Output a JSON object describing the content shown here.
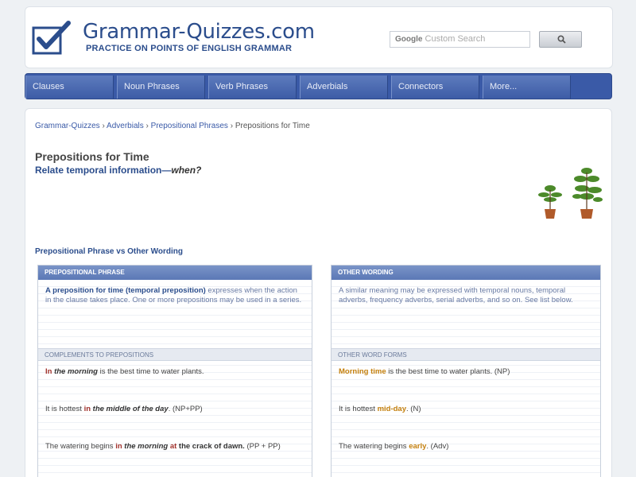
{
  "header": {
    "site_title": "Grammar-Quizzes.com",
    "tagline": "PRACTICE ON POINTS OF ENGLISH GRAMMAR",
    "search_placeholder": "Custom Search",
    "search_brand": "Google"
  },
  "nav": {
    "items": [
      "Clauses",
      "Noun Phrases",
      "Verb Phrases",
      "Adverbials",
      "Connectors",
      "More..."
    ]
  },
  "breadcrumb": {
    "items": [
      "Grammar-Quizzes",
      "Adverbials",
      "Prepositional Phrases"
    ],
    "separator": "›",
    "current": "Prepositions for Time"
  },
  "page": {
    "title": "Prepositions for Time",
    "subtitle_main": "Relate temporal information—",
    "subtitle_em": "when?",
    "section_heading": "Prepositional Phrase vs Other Wording"
  },
  "left_panel": {
    "header": "PREPOSITIONAL PHRASE",
    "body_bold": "A preposition for time (temporal preposition)",
    "body_rest": " expresses when the action in the clause takes place. One or more prepositions may be used in a series.",
    "subheader": "COMPLEMENTS TO PREPOSITIONS",
    "ex1": {
      "hl1": "In",
      "hl2": "the morning",
      "rest": " is the best time to water plants."
    },
    "ex2": {
      "pre": "It is hottest ",
      "hl1": "in",
      "hl2": "the middle of the day",
      "post": ". (NP+PP)"
    },
    "ex3": {
      "pre": "The watering begins ",
      "hl1": "in",
      "hl2": "the morning",
      "hl3": "at",
      "hl4": "the crack of dawn.",
      "post": " (PP + PP)"
    }
  },
  "right_panel": {
    "header": "OTHER WORDING",
    "body": "A similar meaning may be expressed with temporal nouns, temporal adverbs, frequency adverbs, serial adverbs, and so on. See list below.",
    "subheader": "OTHER WORD FORMS",
    "ex1": {
      "hl": "Morning time",
      "rest": " is the best time to water plants. (NP)"
    },
    "ex2": {
      "pre": "It is hottest ",
      "hl": "mid-day",
      "post": ". (N)"
    },
    "ex3": {
      "pre": "The watering begins ",
      "hl": "early",
      "post": ". (Adv)"
    }
  },
  "colors": {
    "brand_blue": "#2b4d8c",
    "nav_blue": "#3a5aa7",
    "highlight_red": "#a2322c",
    "highlight_orange": "#c4800e"
  },
  "icons": [
    "checkmark-logo-icon",
    "search-icon",
    "potted-plants-image"
  ]
}
